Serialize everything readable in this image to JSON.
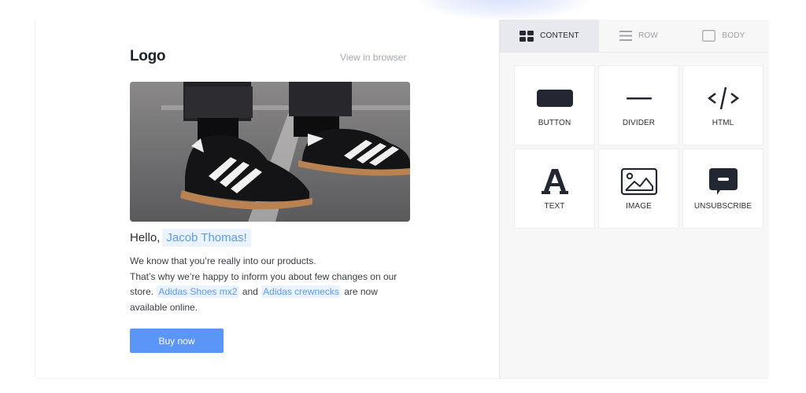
{
  "email": {
    "logo": "Logo",
    "view_in_browser": "View in browser",
    "hero_image_alt": "Black Adidas sneakers with white stripes and gum sole on asphalt",
    "greeting": "Hello,",
    "recipient_name": "Jacob Thomas!",
    "paragraph": {
      "line1": "We know that you’re really into our products.",
      "line2": "That’s why we’re happy to inform you about few changes on our",
      "store_prefix": "store.",
      "product1": "Adidas Shoes mx2",
      "and": "and",
      "product2": "Adidas crewnecks",
      "suffix": "are now",
      "line4": "available online."
    },
    "cta_label": "Buy now",
    "colors": {
      "accent": "#5b96f7",
      "tag_bg": "#eaf3ff",
      "tag_text": "#5a9bf8"
    }
  },
  "panel": {
    "tabs": [
      {
        "label": "CONTENT",
        "icon": "grid-icon",
        "active": true
      },
      {
        "label": "ROW",
        "icon": "rows-icon",
        "active": false
      },
      {
        "label": "BODY",
        "icon": "square-icon",
        "active": false
      }
    ],
    "blocks": [
      {
        "label": "BUTTON",
        "icon": "button-icon"
      },
      {
        "label": "DIVIDER",
        "icon": "divider-icon"
      },
      {
        "label": "HTML",
        "icon": "code-icon"
      },
      {
        "label": "TEXT",
        "icon": "text-icon"
      },
      {
        "label": "IMAGE",
        "icon": "image-icon"
      },
      {
        "label": "UNSUBSCRIBE",
        "icon": "unsubscribe-icon"
      }
    ]
  }
}
